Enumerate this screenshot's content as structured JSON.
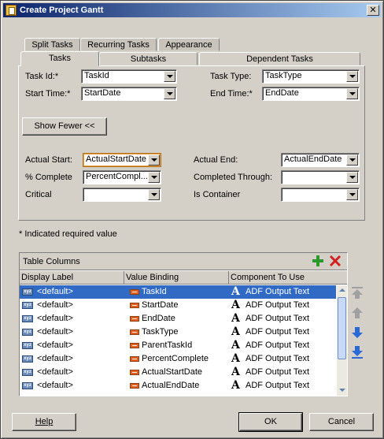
{
  "window": {
    "title": "Create Project Gantt",
    "close_label": "✕"
  },
  "tabs": {
    "back_row": [
      "Split Tasks",
      "Recurring Tasks",
      "Appearance"
    ],
    "front_row": [
      "Tasks",
      "Subtasks",
      "Dependent Tasks"
    ],
    "selected": "Tasks"
  },
  "fields": {
    "task_id": {
      "label": "Task Id:*",
      "value": "TaskId"
    },
    "task_type": {
      "label": "Task Type:",
      "value": "TaskType"
    },
    "start_time": {
      "label": "Start Time:*",
      "value": "StartDate"
    },
    "end_time": {
      "label": "End Time:*",
      "value": "EndDate"
    },
    "actual_start": {
      "label": "Actual Start:",
      "value": "ActualStartDate"
    },
    "actual_end": {
      "label": "Actual End:",
      "value": "ActualEndDate"
    },
    "percent_complete": {
      "label": "% Complete",
      "value": "PercentCompl..."
    },
    "completed_through": {
      "label": "Completed Through:",
      "value": ""
    },
    "critical": {
      "label": "Critical",
      "value": ""
    },
    "is_container": {
      "label": "Is Container",
      "value": ""
    }
  },
  "show_fewer_label": "Show Fewer <<",
  "required_note": "* Indicated required value",
  "table": {
    "title": "Table Columns",
    "columns": [
      "Display Label",
      "Value Binding",
      "Component To Use"
    ],
    "rows": [
      {
        "label": "<default>",
        "binding": "TaskId",
        "component": "ADF Output Text"
      },
      {
        "label": "<default>",
        "binding": "StartDate",
        "component": "ADF Output Text"
      },
      {
        "label": "<default>",
        "binding": "EndDate",
        "component": "ADF Output Text"
      },
      {
        "label": "<default>",
        "binding": "TaskType",
        "component": "ADF Output Text"
      },
      {
        "label": "<default>",
        "binding": "ParentTaskId",
        "component": "ADF Output Text"
      },
      {
        "label": "<default>",
        "binding": "PercentComplete",
        "component": "ADF Output Text"
      },
      {
        "label": "<default>",
        "binding": "ActualStartDate",
        "component": "ADF Output Text"
      },
      {
        "label": "<default>",
        "binding": "ActualEndDate",
        "component": "ADF Output Text"
      }
    ],
    "icon_text": "xyz"
  },
  "buttons": {
    "help": "Help",
    "ok": "OK",
    "cancel": "Cancel"
  },
  "colors": {
    "selection": "#316ac5",
    "add": "#2a9a2a",
    "remove": "#d02020",
    "arrow_blue": "#2a6ad8"
  }
}
